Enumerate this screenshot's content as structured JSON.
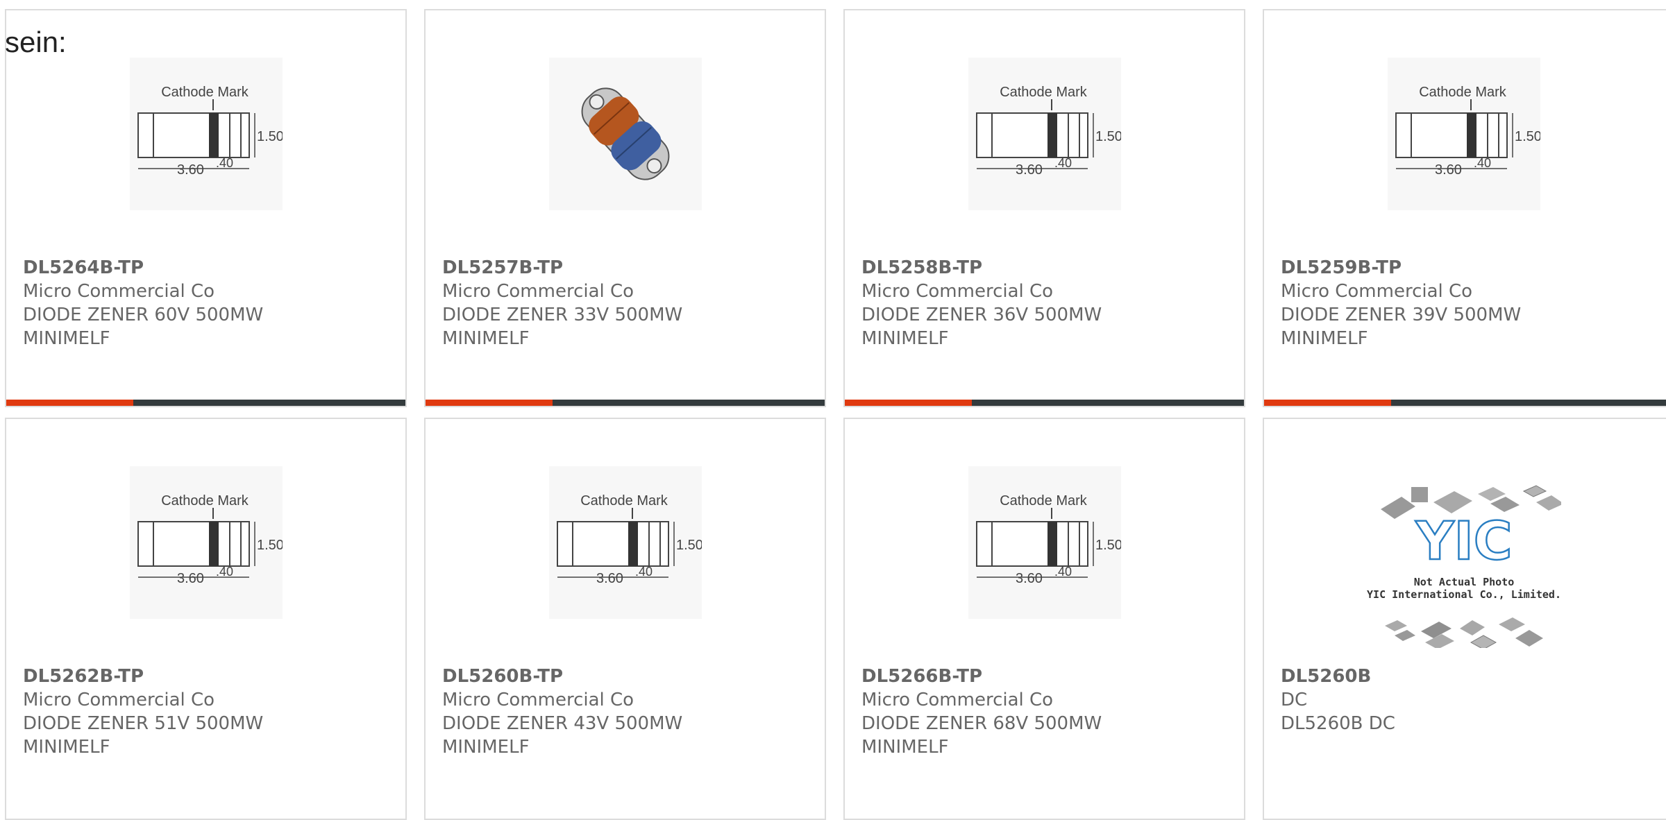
{
  "page": {
    "heading": "sein:"
  },
  "colors": {
    "accent": "#e03a10",
    "bar": "#333b3d",
    "border": "#dcdcdc",
    "text": "#666666"
  },
  "drawing": {
    "cathode_mark": "Cathode Mark",
    "length": "3.60",
    "height": "1.50",
    "band": ".40"
  },
  "placeholder": {
    "line1": "Not Actual Photo",
    "line2": "YIC International Co., Limited."
  },
  "products": [
    {
      "part": "DL5264B-TP",
      "maker": "Micro Commercial Co",
      "desc": "DIODE ZENER 60V 500MW",
      "pkg": "MINIMELF",
      "image": "minimelf-drawing"
    },
    {
      "part": "DL5257B-TP",
      "maker": "Micro Commercial Co",
      "desc": "DIODE ZENER 33V 500MW",
      "pkg": "MINIMELF",
      "image": "minimelf-photo"
    },
    {
      "part": "DL5258B-TP",
      "maker": "Micro Commercial Co",
      "desc": "DIODE ZENER 36V 500MW",
      "pkg": "MINIMELF",
      "image": "minimelf-drawing"
    },
    {
      "part": "DL5259B-TP",
      "maker": "Micro Commercial Co",
      "desc": "DIODE ZENER 39V 500MW",
      "pkg": "MINIMELF",
      "image": "minimelf-drawing"
    },
    {
      "part": "DL5262B-TP",
      "maker": "Micro Commercial Co",
      "desc": "DIODE ZENER 51V 500MW",
      "pkg": "MINIMELF",
      "image": "minimelf-drawing"
    },
    {
      "part": "DL5260B-TP",
      "maker": "Micro Commercial Co",
      "desc": "DIODE ZENER 43V 500MW",
      "pkg": "MINIMELF",
      "image": "minimelf-drawing"
    },
    {
      "part": "DL5266B-TP",
      "maker": "Micro Commercial Co",
      "desc": "DIODE ZENER 68V 500MW",
      "pkg": "MINIMELF",
      "image": "minimelf-drawing"
    },
    {
      "part": "DL5260B",
      "maker": "DC",
      "desc": "DL5260B DC",
      "pkg": "",
      "image": "yic-placeholder"
    }
  ]
}
